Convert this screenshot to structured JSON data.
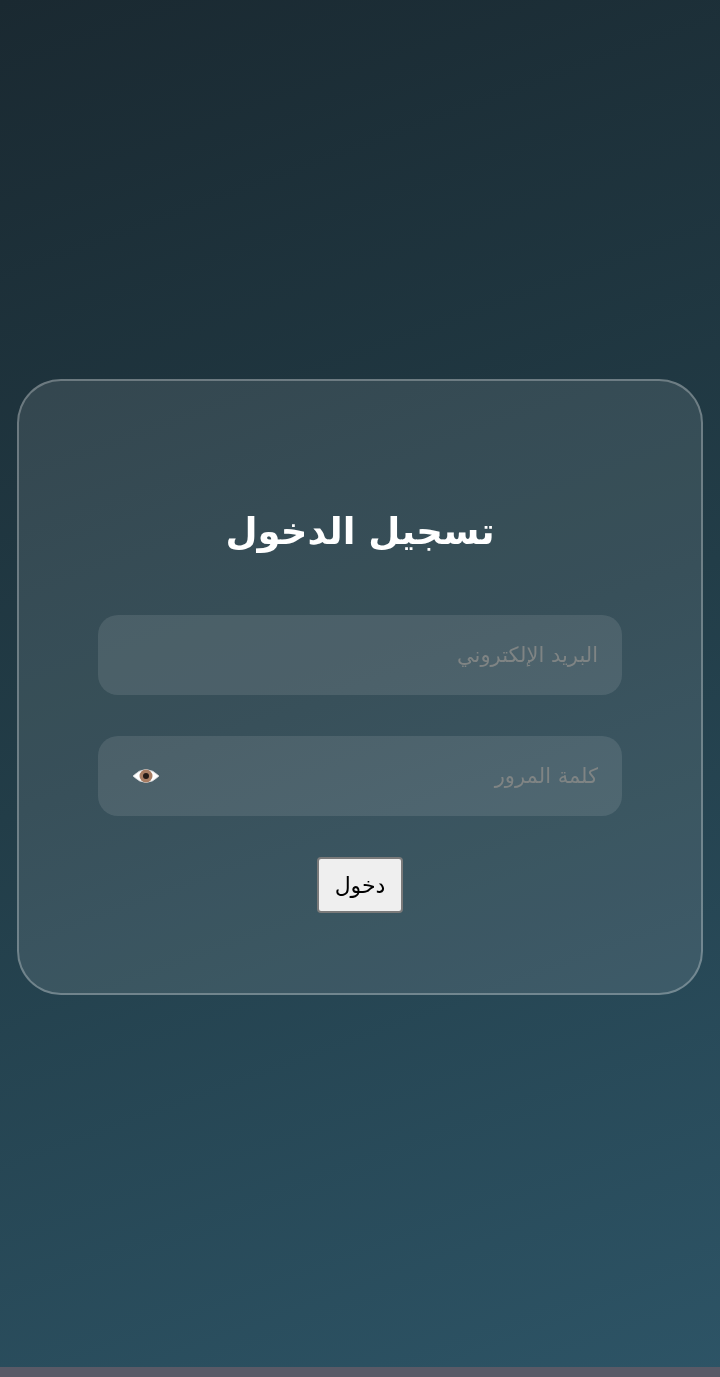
{
  "title": "تسجيل الدخول",
  "fields": [
    {
      "kind": "email",
      "placeholder": "البريد الإلكتروني"
    },
    {
      "kind": "password",
      "placeholder": "كلمة المرور"
    }
  ],
  "submit_button": {
    "label": "دخول"
  }
}
